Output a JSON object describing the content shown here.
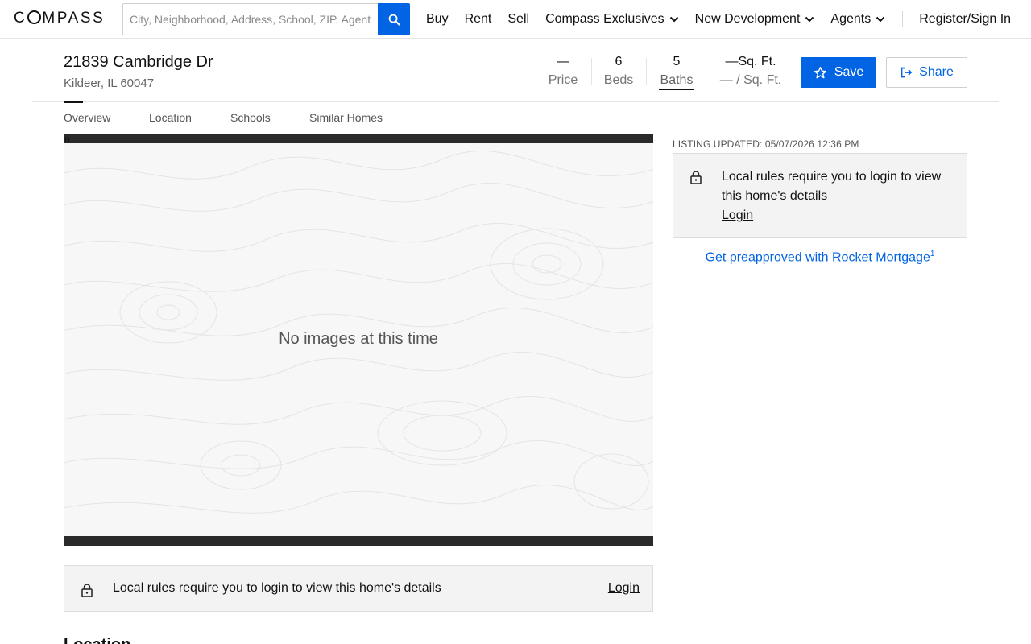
{
  "nav": {
    "logo": "COMPASS",
    "search_placeholder": "City, Neighborhood, Address, School, ZIP, Agent",
    "items": [
      {
        "label": "Buy"
      },
      {
        "label": "Rent"
      },
      {
        "label": "Sell"
      },
      {
        "label": "Compass Exclusives"
      },
      {
        "label": "New Development"
      },
      {
        "label": "Agents"
      }
    ],
    "signin": "Register/Sign In"
  },
  "listing": {
    "address": "21839 Cambridge Dr",
    "city": "Kildeer, IL 60047",
    "stats": {
      "price_value": "—",
      "price_label": "Price",
      "beds_value": "6",
      "beds_label": "Beds",
      "baths_value": "5",
      "baths_label": "Baths",
      "sqft_value": "—Sq. Ft.",
      "sqft_label": "— / Sq. Ft."
    },
    "save_label": "Save",
    "share_label": "Share"
  },
  "tabs": [
    {
      "label": "Overview"
    },
    {
      "label": "Location"
    },
    {
      "label": "Schools"
    },
    {
      "label": "Similar Homes"
    }
  ],
  "media": {
    "no_images": "No images at this time",
    "corner_glyph": "n"
  },
  "login_bar": {
    "message": "Local rules require you to login to view this home's details",
    "login": "Login"
  },
  "next_section_heading": "Location",
  "sidebar": {
    "updated": "LISTING UPDATED: 05/07/2026 12:36 PM",
    "message": "Local rules require you to login to view this home's details",
    "login": "Login",
    "mortgage_link": "Get preapproved with Rocket Mortgage",
    "mortgage_sup": "1"
  },
  "colors": {
    "accent": "#0064e5",
    "panel_bg": "#f3f3f3"
  }
}
